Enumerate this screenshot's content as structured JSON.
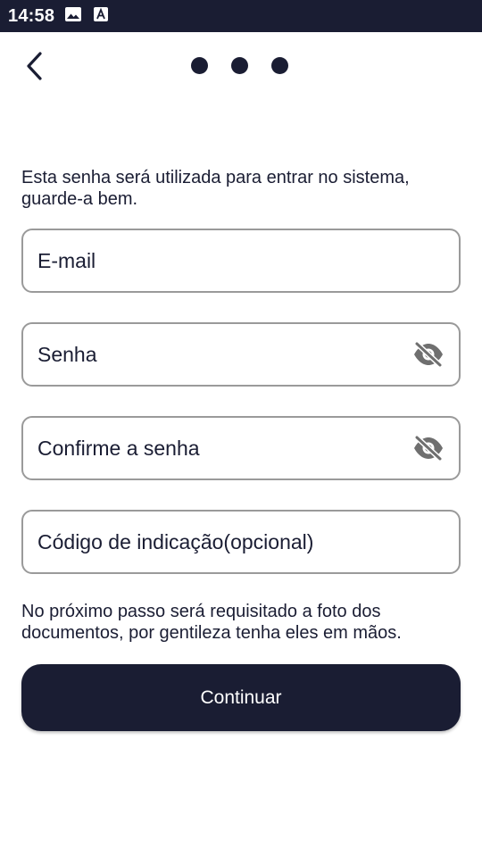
{
  "status_bar": {
    "time": "14:58",
    "icons": [
      "image-icon",
      "accessibility-icon"
    ]
  },
  "nav": {
    "back_icon": "chevron-left-icon",
    "steps_total": 3
  },
  "intro_text": "Esta senha será utilizada para entrar no sistema, guarde-a bem.",
  "form": {
    "email": {
      "placeholder": "E-mail",
      "value": ""
    },
    "password": {
      "placeholder": "Senha",
      "value": "",
      "toggle_icon": "eye-off-icon"
    },
    "confirm_password": {
      "placeholder": "Confirme a senha",
      "value": "",
      "toggle_icon": "eye-off-icon"
    },
    "referral_code": {
      "placeholder": "Código de indicação(opcional)",
      "value": ""
    }
  },
  "note_text": "No próximo passo será requisitado a foto dos documentos, por gentileza tenha eles em mãos.",
  "continue_label": "Continuar",
  "colors": {
    "primary": "#1a1d33",
    "field_border": "#9a9a9a",
    "background": "#ffffff"
  }
}
